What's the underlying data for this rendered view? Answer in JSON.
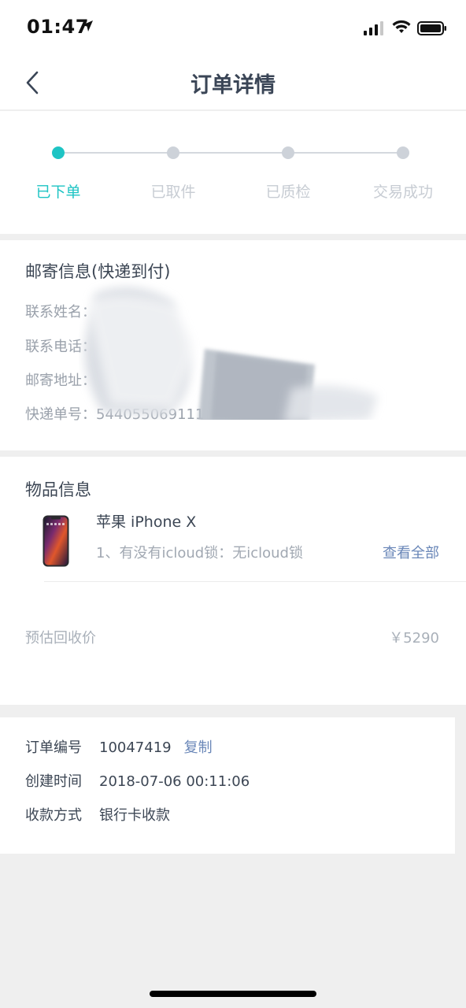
{
  "status_bar": {
    "time": "01:47"
  },
  "nav": {
    "title": "订单详情"
  },
  "progress": {
    "steps": [
      {
        "label": "已下单",
        "active": true
      },
      {
        "label": "已取件",
        "active": false
      },
      {
        "label": "已质检",
        "active": false
      },
      {
        "label": "交易成功",
        "active": false
      }
    ]
  },
  "shipping": {
    "title": "邮寄信息(快递到付)",
    "contact_name_label": "联系姓名：",
    "contact_phone_label": "联系电话：",
    "address_label": "邮寄地址：",
    "tracking_label": "快递单号：",
    "tracking_value": "544055069111"
  },
  "item": {
    "title": "物品信息",
    "name": "苹果 iPhone X",
    "attribute": "1、有没有icloud锁：无icloud锁",
    "view_all": "查看全部",
    "price_label": "预估回收价",
    "price_value": "￥5290"
  },
  "order": {
    "number_label": "订单编号",
    "number_value": "10047419",
    "copy_label": "复制",
    "created_label": "创建时间",
    "created_value": "2018-07-06 00:11:06",
    "payment_label": "收款方式",
    "payment_value": "银行卡收款"
  },
  "colors": {
    "accent": "#1ec4c4",
    "link": "#6a87b8"
  }
}
